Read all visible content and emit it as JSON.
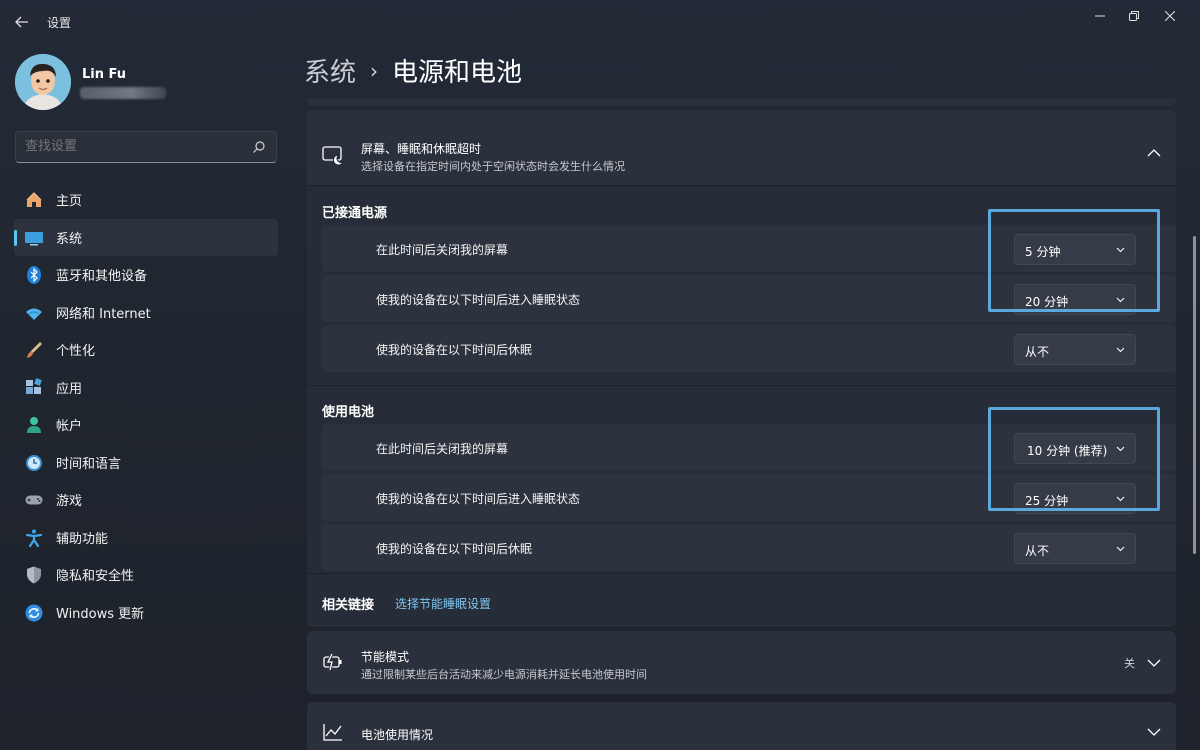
{
  "window": {
    "title": "设置"
  },
  "profile": {
    "name": "Lin Fu"
  },
  "search": {
    "placeholder": "查找设置"
  },
  "sidebar": {
    "items": [
      {
        "label": "主页",
        "icon": "home-icon",
        "active": false
      },
      {
        "label": "系统",
        "icon": "system-icon",
        "active": true
      },
      {
        "label": "蓝牙和其他设备",
        "icon": "bluetooth-icon",
        "active": false
      },
      {
        "label": "网络和 Internet",
        "icon": "wifi-icon",
        "active": false
      },
      {
        "label": "个性化",
        "icon": "brush-icon",
        "active": false
      },
      {
        "label": "应用",
        "icon": "apps-icon",
        "active": false
      },
      {
        "label": "帐户",
        "icon": "account-icon",
        "active": false
      },
      {
        "label": "时间和语言",
        "icon": "time-language-icon",
        "active": false
      },
      {
        "label": "游戏",
        "icon": "gamepad-icon",
        "active": false
      },
      {
        "label": "辅助功能",
        "icon": "accessibility-icon",
        "active": false
      },
      {
        "label": "隐私和安全性",
        "icon": "shield-icon",
        "active": false
      },
      {
        "label": "Windows 更新",
        "icon": "update-icon",
        "active": false
      }
    ]
  },
  "header": {
    "parent": "系统",
    "separator": "›",
    "current": "电源和电池"
  },
  "screen_sleep_card": {
    "title": "屏幕、睡眠和休眠超时",
    "subtitle": "选择设备在指定时间内处于空闲状态时会发生什么情况",
    "plugged_in": {
      "label": "已接通电源",
      "rows": [
        {
          "label": "在此时间后关闭我的屏幕",
          "value": "5 分钟"
        },
        {
          "label": "使我的设备在以下时间后进入睡眠状态",
          "value": "20 分钟"
        },
        {
          "label": "使我的设备在以下时间后休眠",
          "value": "从不"
        }
      ]
    },
    "on_battery": {
      "label": "使用电池",
      "rows": [
        {
          "label": "在此时间后关闭我的屏幕",
          "value": "10 分钟 (推荐)"
        },
        {
          "label": "使我的设备在以下时间后进入睡眠状态",
          "value": "25 分钟"
        },
        {
          "label": "使我的设备在以下时间后休眠",
          "value": "从不"
        }
      ]
    }
  },
  "related": {
    "label": "相关链接",
    "link": "选择节能睡眠设置"
  },
  "energy_saver": {
    "title": "节能模式",
    "subtitle": "通过限制某些后台活动来减少电源消耗并延长电池使用时间",
    "status": "关"
  },
  "battery_usage": {
    "title": "电池使用情况"
  },
  "colors": {
    "accent": "#60c3f2",
    "highlight_box": "#5aa9dc",
    "link": "#7fc6f2"
  }
}
